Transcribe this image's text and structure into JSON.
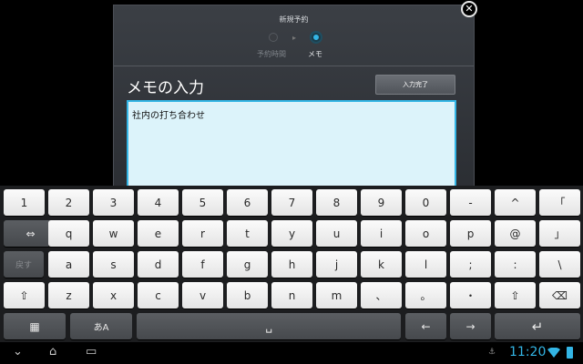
{
  "dialog": {
    "title": "新規予約",
    "steps": [
      {
        "label": "予約時間",
        "active": false
      },
      {
        "label": "メモ",
        "active": true
      }
    ],
    "heading": "メモの入力",
    "done_label": "入力完了",
    "memo_value": "社内の打ち合わせ"
  },
  "close_label": "✕",
  "keyboard": {
    "row1": [
      "1",
      "2",
      "3",
      "4",
      "5",
      "6",
      "7",
      "8",
      "9",
      "0",
      "-",
      "^",
      "「"
    ],
    "row2": [
      "⇔",
      "q",
      "w",
      "e",
      "r",
      "t",
      "y",
      "u",
      "i",
      "o",
      "p",
      "@",
      "」"
    ],
    "row3": [
      "戻す",
      "a",
      "s",
      "d",
      "f",
      "g",
      "h",
      "j",
      "k",
      "l",
      ";",
      ":",
      "\\"
    ],
    "row4": [
      "⇧",
      "z",
      "x",
      "c",
      "v",
      "b",
      "n",
      "m",
      "、",
      "。",
      "・",
      "⇧",
      "⌫"
    ],
    "row5": [
      "▦",
      "あA",
      "␣",
      "←",
      "→",
      "↵"
    ]
  },
  "statusbar": {
    "clock": "11:20",
    "accent_color": "#33b5e5"
  }
}
